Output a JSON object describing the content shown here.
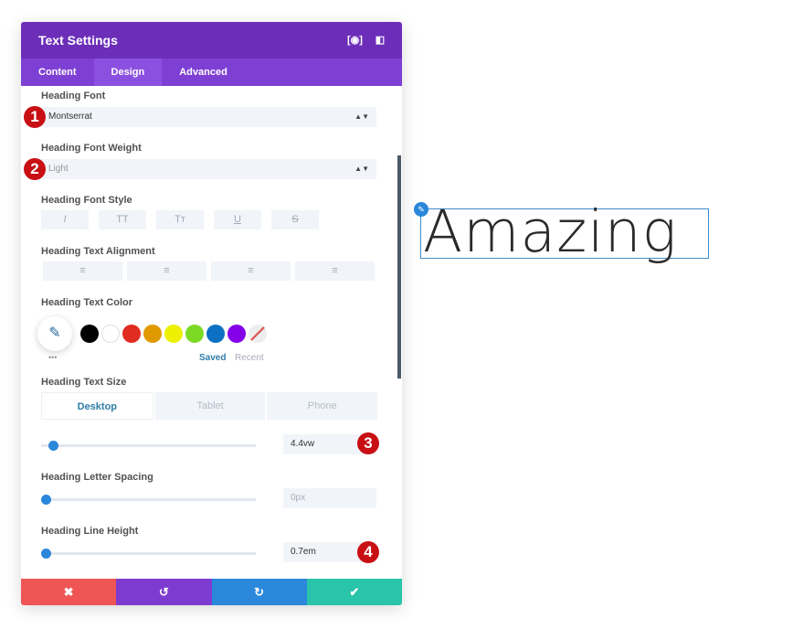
{
  "panel": {
    "title": "Text Settings",
    "tabs": [
      "Content",
      "Design",
      "Advanced"
    ],
    "active_tab": "Design"
  },
  "fields": {
    "heading_font": {
      "label": "Heading Font",
      "value": "Montserrat",
      "badge": "1"
    },
    "heading_font_weight": {
      "label": "Heading Font Weight",
      "value": "Light",
      "badge": "2"
    },
    "heading_font_style": {
      "label": "Heading Font Style",
      "buttons": [
        "I",
        "TT",
        "Tт",
        "U",
        "S"
      ]
    },
    "heading_text_alignment": {
      "label": "Heading Text Alignment",
      "buttons": [
        "≡",
        "≡",
        "≡",
        "≡"
      ]
    },
    "heading_text_color": {
      "label": "Heading Text Color",
      "swatches": [
        "#000000",
        "#ffffff",
        "#e02b20",
        "#e09900",
        "#edf000",
        "#7cda24",
        "#0c71c3",
        "#8300e9"
      ],
      "saved": "Saved",
      "recent": "Recent",
      "more": "•••"
    },
    "heading_text_size": {
      "label": "Heading Text Size",
      "devices": [
        "Desktop",
        "Tablet",
        "Phone"
      ],
      "value": "4.4vw",
      "badge": "3"
    },
    "heading_letter_spacing": {
      "label": "Heading Letter Spacing",
      "value": "0px"
    },
    "heading_line_height": {
      "label": "Heading Line Height",
      "value": "0.7em",
      "badge": "4"
    }
  },
  "footer": {
    "cancel": "✖",
    "undo": "↺",
    "redo": "↻",
    "save": "✔",
    "colors": [
      "#ef5555",
      "#7e3bd0",
      "#2b87da",
      "#29c4a9"
    ]
  },
  "preview": {
    "heading": "Amazing"
  }
}
